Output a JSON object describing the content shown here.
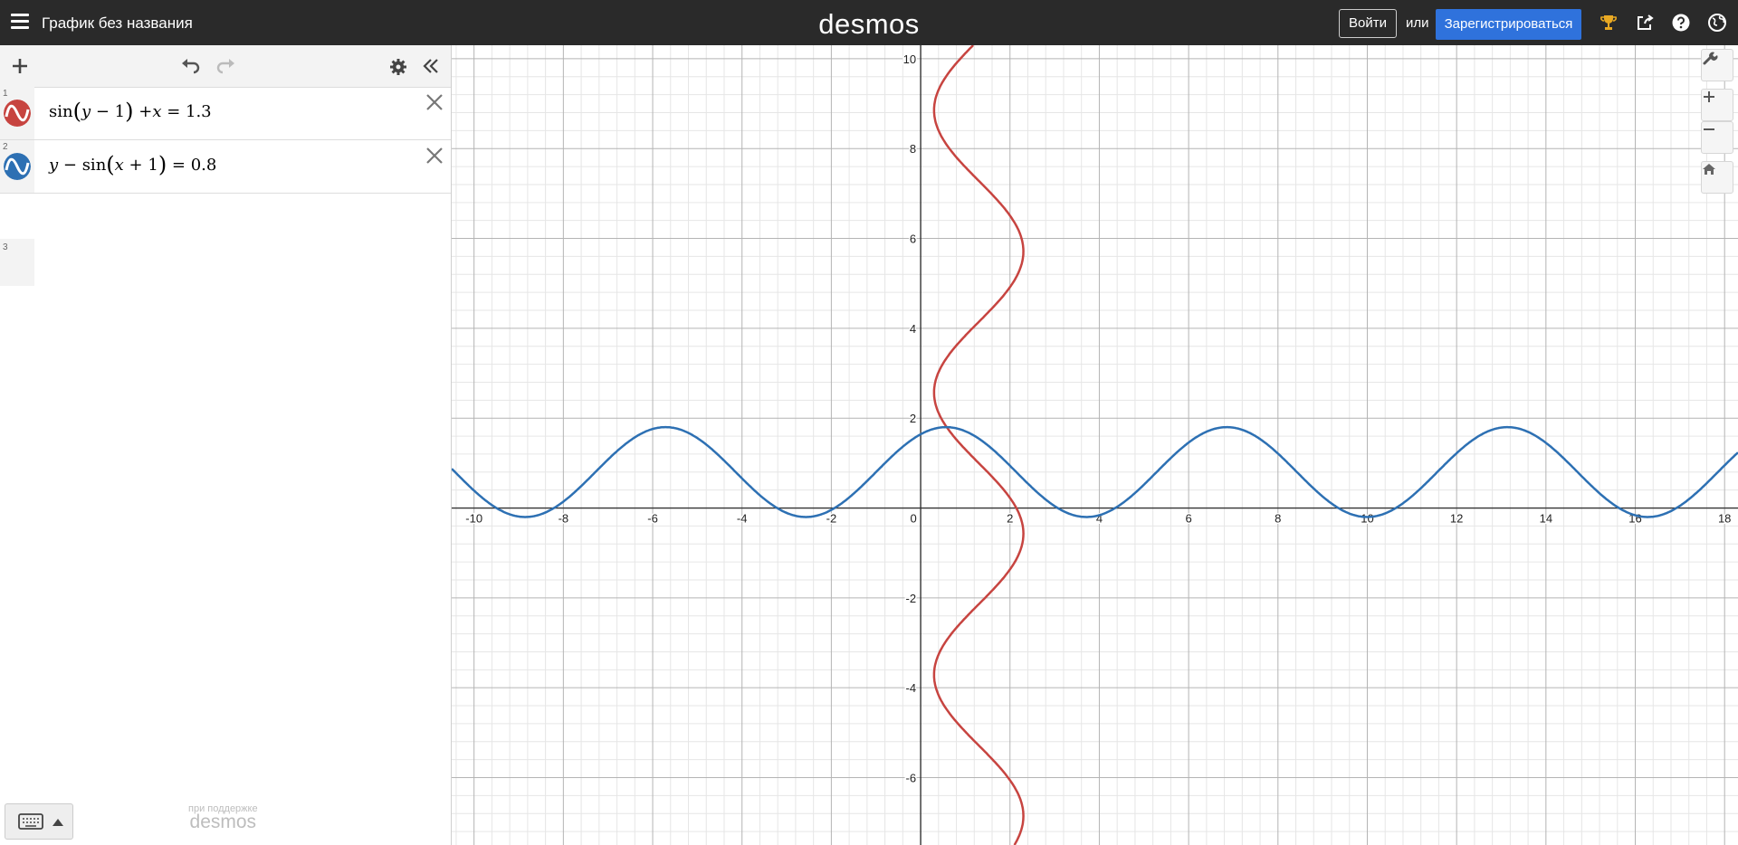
{
  "header": {
    "graph_title": "График без названия",
    "brand": "desmos",
    "login_label": "Войти",
    "or_label": "или",
    "signup_label": "Зарегистрироваться",
    "icons": [
      "menu-icon",
      "trophy-icon",
      "share-icon",
      "help-icon",
      "globe-icon"
    ]
  },
  "toolbar": {
    "icons": [
      "add-icon",
      "undo-icon",
      "redo-icon",
      "settings-icon",
      "collapse-icon"
    ]
  },
  "expressions": [
    {
      "index": "1",
      "color": "#c74440",
      "parts": [
        "sin",
        "(",
        "y",
        " − 1",
        ")",
        " +",
        "x",
        " = 1.3"
      ]
    },
    {
      "index": "2",
      "color": "#2d70b3",
      "parts": [
        "y",
        " − sin",
        "(",
        "x",
        " + 1",
        ")",
        " = 0.8"
      ]
    },
    {
      "index": "3"
    }
  ],
  "footer": {
    "powered_by": "при поддержке",
    "powered_brand": "desmos",
    "keyboard_icons": [
      "keyboard-icon",
      "triangle-up-icon"
    ]
  },
  "graph": {
    "x_range": [
      -10.5,
      18.3
    ],
    "y_range": [
      -7.5,
      10.3
    ],
    "x_tick_labels": [
      "-10",
      "-8",
      "-6",
      "-4",
      "-2",
      "0",
      "2",
      "4",
      "6",
      "8",
      "10",
      "12",
      "14",
      "16",
      "18"
    ],
    "y_tick_labels": [
      "10",
      "8",
      "6",
      "4",
      "2",
      "-2",
      "-4",
      "-6"
    ],
    "major_step": 2,
    "minor_step": 0.4,
    "grid": true,
    "curve_colors": {
      "red": "#c74440",
      "blue": "#2d70b3"
    },
    "side_icons": [
      "wrench-icon",
      "zoom-in-icon",
      "zoom-out-icon",
      "home-icon"
    ]
  }
}
